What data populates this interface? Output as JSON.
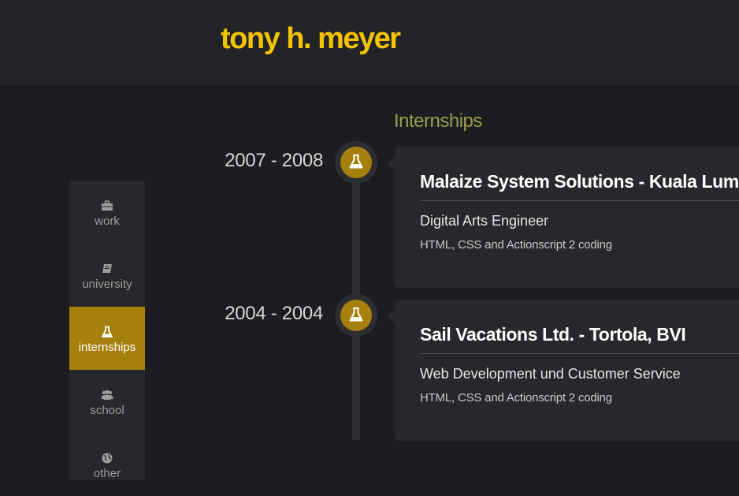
{
  "site": {
    "title": "tony h. meyer"
  },
  "sidebar": {
    "items": [
      {
        "label": "work",
        "icon": "briefcase-icon",
        "active": false
      },
      {
        "label": "university",
        "icon": "book-icon",
        "active": false
      },
      {
        "label": "internships",
        "icon": "flask-icon",
        "active": true
      },
      {
        "label": "school",
        "icon": "group-icon",
        "active": false
      },
      {
        "label": "other",
        "icon": "globe-icon",
        "active": false
      }
    ]
  },
  "section": {
    "title": "Internships"
  },
  "entries": [
    {
      "years": "2007 - 2008",
      "icon": "flask-icon",
      "title": "Malaize System Solutions - Kuala Lumpur",
      "role": "Digital Arts Engineer",
      "description": "HTML, CSS and Actionscript 2 coding"
    },
    {
      "years": "2004 - 2004",
      "icon": "flask-icon",
      "title": "Sail Vacations Ltd. - Tortola, BVI",
      "role": "Web Development und Customer Service",
      "description": "HTML, CSS and Actionscript 2 coding"
    }
  ],
  "colors": {
    "accent": "#f5c400",
    "active": "#a6800c",
    "section_title": "#9a9e4c",
    "background": "#1c1d20"
  }
}
